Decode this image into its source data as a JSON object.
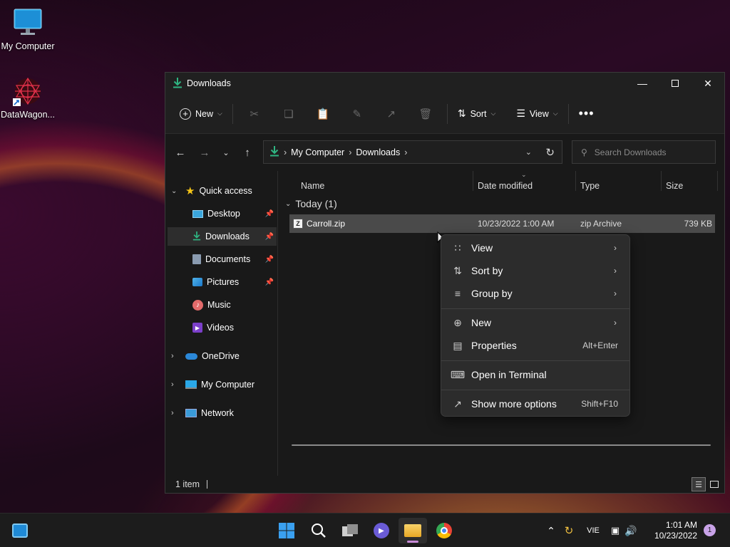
{
  "desktop": {
    "icons": [
      {
        "label": "My Computer",
        "icon": "monitor-icon"
      },
      {
        "label": "DataWagon...",
        "icon": "app-shortcut-icon"
      }
    ]
  },
  "window": {
    "title": "Downloads",
    "toolbar": {
      "new_label": "New",
      "sort_label": "Sort",
      "view_label": "View"
    },
    "address": {
      "crumbs": [
        "My Computer",
        "Downloads"
      ]
    },
    "search": {
      "placeholder": "Search Downloads"
    },
    "sidebar": {
      "quick_access": "Quick access",
      "items": [
        {
          "label": "Desktop",
          "pinned": true
        },
        {
          "label": "Downloads",
          "pinned": true
        },
        {
          "label": "Documents",
          "pinned": true
        },
        {
          "label": "Pictures",
          "pinned": true
        },
        {
          "label": "Music",
          "pinned": false
        },
        {
          "label": "Videos",
          "pinned": false
        }
      ],
      "roots": [
        "OneDrive",
        "My Computer",
        "Network"
      ]
    },
    "columns": [
      "Name",
      "Date modified",
      "Type",
      "Size"
    ],
    "group": "Today (1)",
    "files": [
      {
        "name": "Carroll.zip",
        "date": "10/23/2022 1:00 AM",
        "type": "zip Archive",
        "size": "739 KB"
      }
    ],
    "status": "1 item"
  },
  "context_menu": {
    "items": [
      {
        "label": "View",
        "shortcut": "",
        "submenu": true
      },
      {
        "label": "Sort by",
        "shortcut": "",
        "submenu": true
      },
      {
        "label": "Group by",
        "shortcut": "",
        "submenu": true
      },
      {
        "label": "New",
        "shortcut": "",
        "submenu": true
      },
      {
        "label": "Properties",
        "shortcut": "Alt+Enter",
        "submenu": false
      },
      {
        "label": "Open in Terminal",
        "shortcut": "",
        "submenu": false
      },
      {
        "label": "Show more options",
        "shortcut": "Shift+F10",
        "submenu": false
      }
    ]
  },
  "taskbar": {
    "language": "VIE",
    "time": "1:01 AM",
    "date": "10/23/2022",
    "notification_count": "1"
  },
  "colors": {
    "accent": "#0f7a5f",
    "selection": "#4a4a4a",
    "menu_bg": "#2c2c2c"
  }
}
